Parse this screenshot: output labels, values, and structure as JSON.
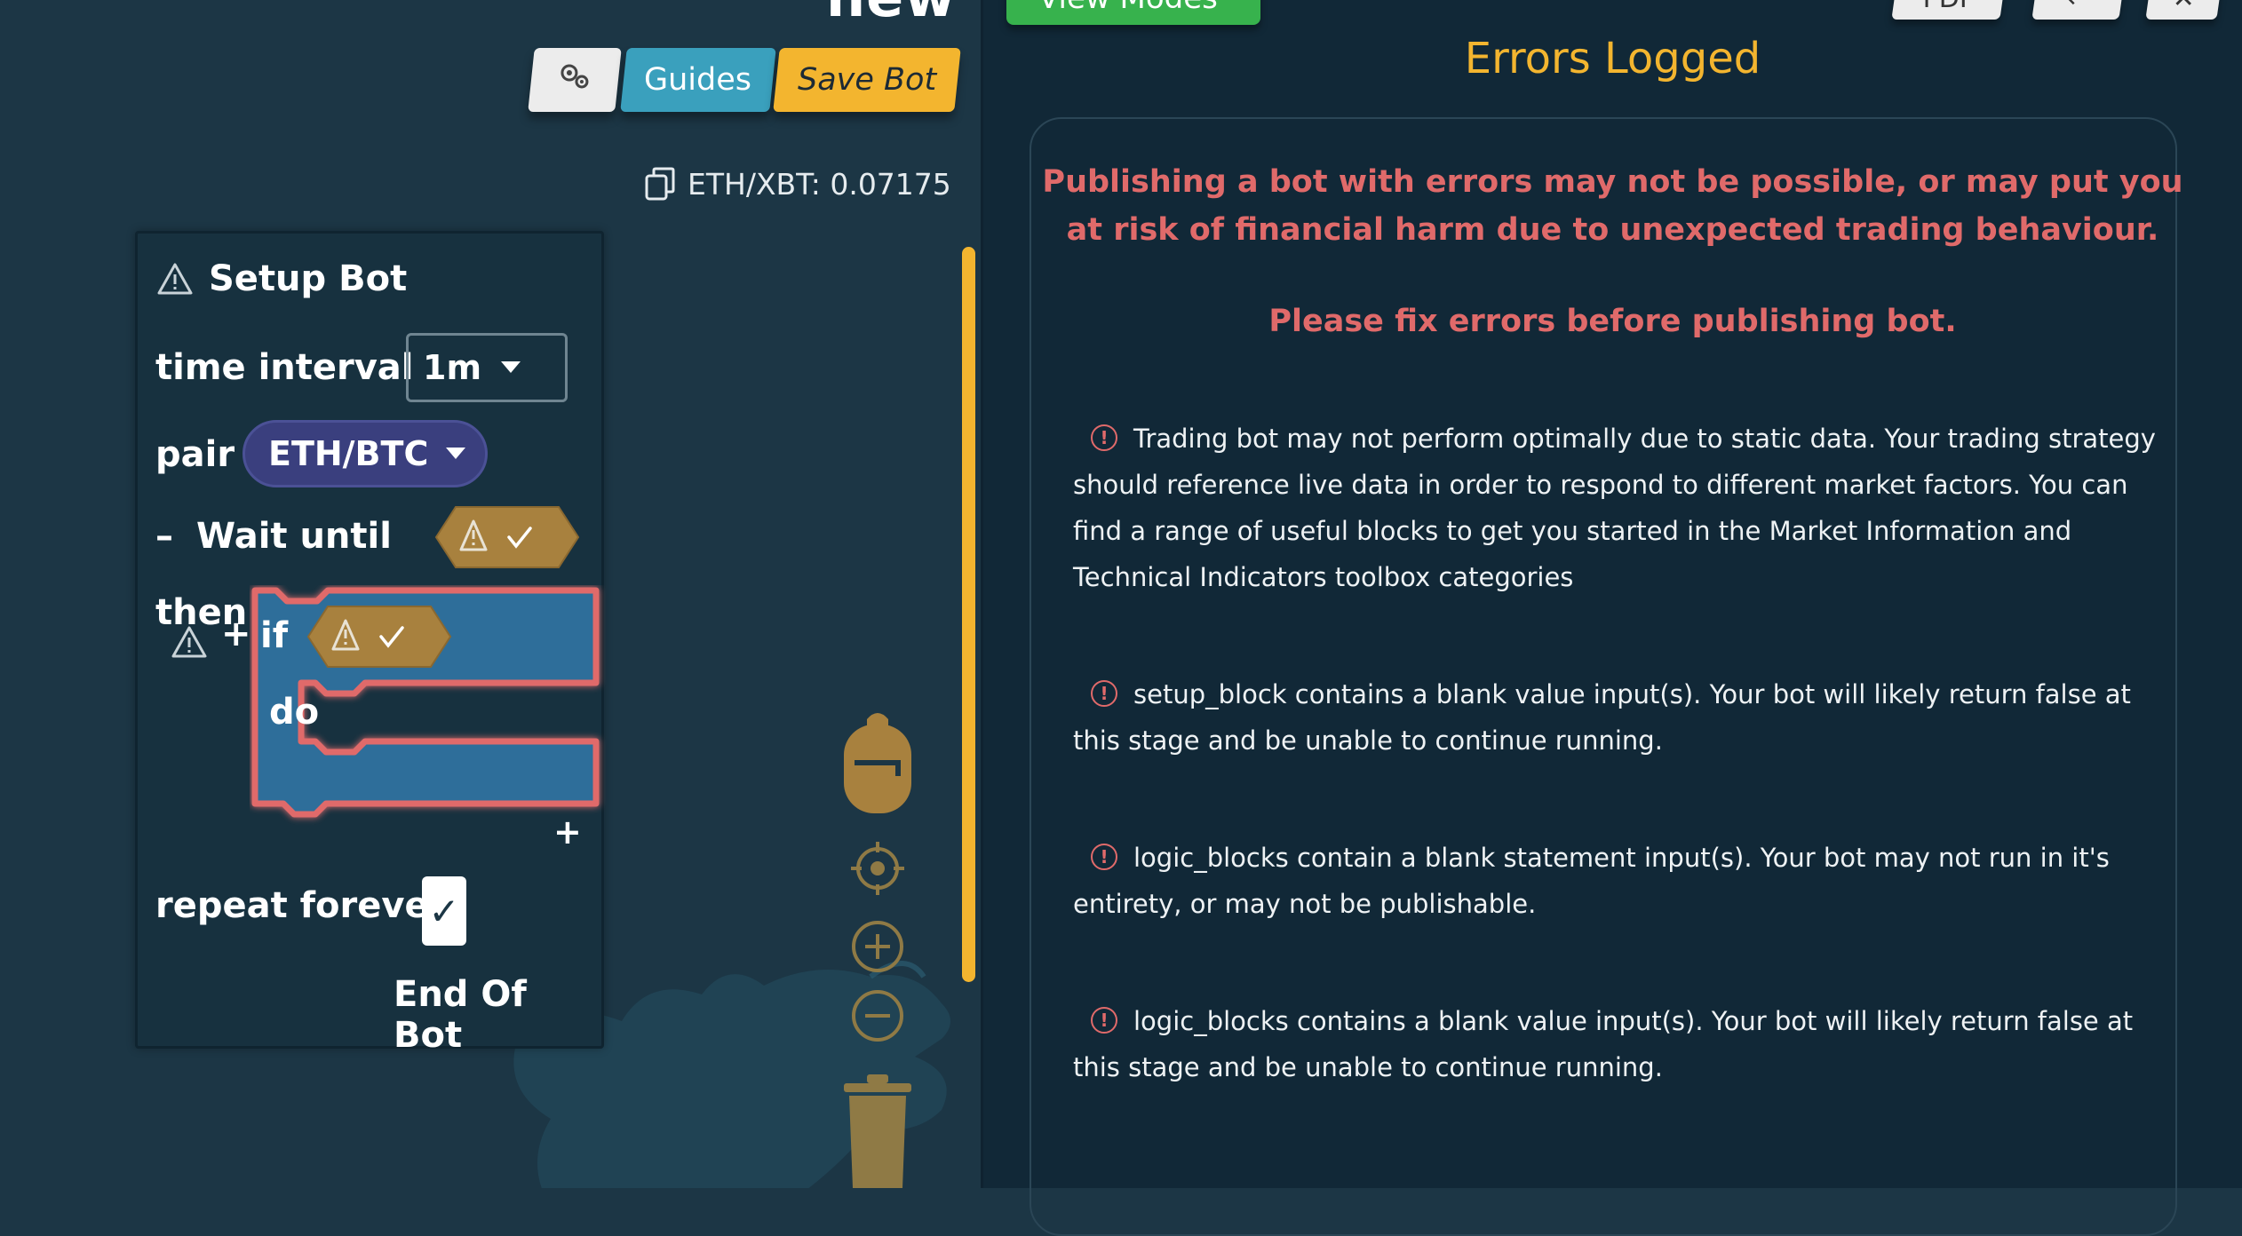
{
  "workspace": {
    "bot_name": "new",
    "toolbar": {
      "guides_label": "Guides",
      "save_label": "Save Bot"
    },
    "price_ticker": "ETH/XBT: 0.07175",
    "setup_block": {
      "title": "Setup Bot",
      "time_interval_label": "time interval",
      "time_interval_value": "1m",
      "pair_label": "pair",
      "pair_value": "ETH/BTC",
      "wait_until_label": "Wait until",
      "then_label": "then",
      "if_label": "if",
      "do_label": "do",
      "repeat_forever_label": "repeat forever",
      "repeat_forever_checked": true,
      "end_label": "End Of Bot"
    },
    "colors": {
      "accent": "#f3b52f",
      "guides": "#3aa0bd",
      "pair": "#3a3f7e",
      "if_block": "#2f6e9a",
      "error_outline": "#e06a6a",
      "logic_slot": "#a8813e"
    },
    "icons": [
      "gears-icon",
      "copy-icon",
      "warning-icon",
      "check-icon",
      "backpack-icon",
      "crosshair-icon",
      "zoom-in-icon",
      "zoom-out-icon",
      "trash-icon"
    ]
  },
  "error_panel": {
    "view_modes_label": "View Modes",
    "pdf_label": "PDF",
    "title": "Errors Logged",
    "warning": "Publishing a bot with errors may not be possible, or may put you at risk of financial harm due to unexpected trading behaviour.",
    "fix_notice": "Please fix errors before publishing bot.",
    "errors": [
      "Trading bot may not perform optimally due to static data. Your trading strategy should reference live data in order to respond to different market factors. You can find a range of useful blocks to get you started in the Market Information and Technical Indicators toolbox categories",
      "setup_block contains a blank value input(s). Your bot will likely return false at this stage and be unable to continue running.",
      "logic_blocks contain a blank statement input(s). Your bot may not run in it's entirety, or may not be publishable.",
      "logic_blocks contains a blank value input(s). Your bot will likely return false at this stage and be unable to continue running."
    ]
  }
}
